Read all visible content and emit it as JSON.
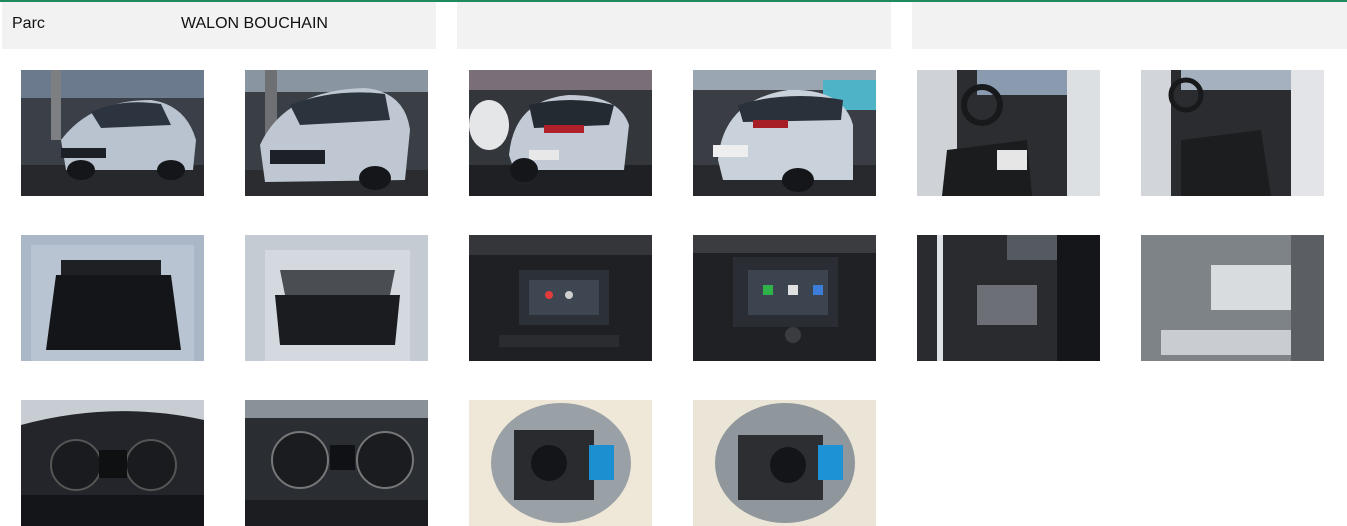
{
  "header": {
    "park_label": "Parc",
    "park_value": "WALON BOUCHAIN"
  },
  "photos": [
    {
      "id": "p1",
      "subject": "car-front-3q-left"
    },
    {
      "id": "p2",
      "subject": "car-front-3q-right"
    },
    {
      "id": "p3",
      "subject": "car-rear-3q-left"
    },
    {
      "id": "p4",
      "subject": "car-rear-3q-right"
    },
    {
      "id": "p5",
      "subject": "interior-driver"
    },
    {
      "id": "p6",
      "subject": "interior-passenger"
    },
    {
      "id": "p7",
      "subject": "trunk-open"
    },
    {
      "id": "p8",
      "subject": "trunk-cargo"
    },
    {
      "id": "p9",
      "subject": "infotainment-screen"
    },
    {
      "id": "p10",
      "subject": "infotainment-screen-close"
    },
    {
      "id": "p11",
      "subject": "door-label"
    },
    {
      "id": "p12",
      "subject": "vin-plate"
    },
    {
      "id": "p13",
      "subject": "instrument-cluster"
    },
    {
      "id": "p14",
      "subject": "instrument-cluster-close"
    },
    {
      "id": "p15",
      "subject": "spare-wheel-well"
    },
    {
      "id": "p16",
      "subject": "spare-wheel-well-close"
    }
  ],
  "colors": {
    "accent_line": "#1f8a5e",
    "header_bg": "#f2f2f2",
    "car_silver": "#b9c3cf"
  }
}
